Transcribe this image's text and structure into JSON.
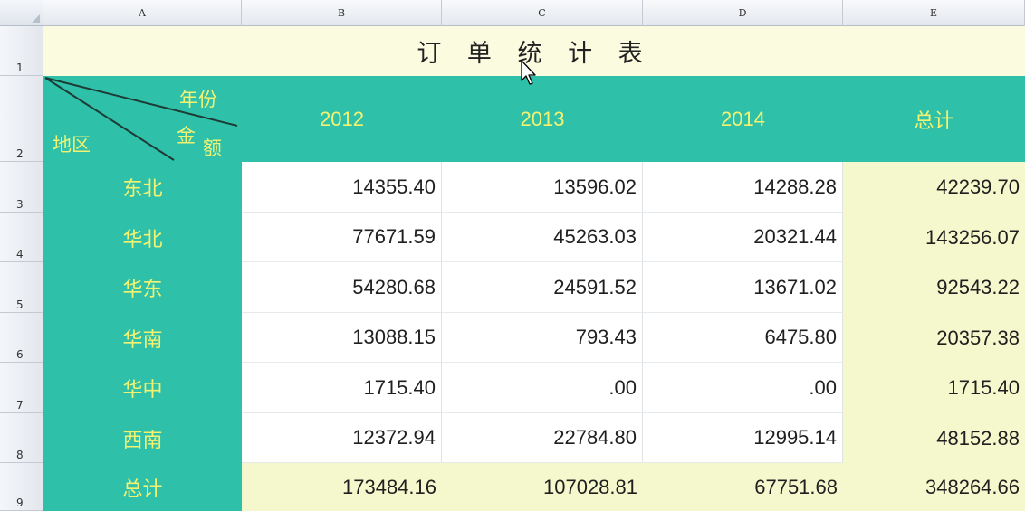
{
  "columns": [
    "A",
    "B",
    "C",
    "D",
    "E"
  ],
  "rows": [
    "1",
    "2",
    "3",
    "4",
    "5",
    "6",
    "7",
    "8",
    "9"
  ],
  "title": "订 单 统 计 表",
  "header": {
    "corner_top": "年份",
    "corner_middle_a": "金",
    "corner_middle_b": "额",
    "corner_bottom": "地区",
    "years": [
      "2012",
      "2013",
      "2014"
    ],
    "total": "总计"
  },
  "data_rows": [
    {
      "region": "东北",
      "v2012": "14355.40",
      "v2013": "13596.02",
      "v2014": "14288.28",
      "total": "42239.70"
    },
    {
      "region": "华北",
      "v2012": "77671.59",
      "v2013": "45263.03",
      "v2014": "20321.44",
      "total": "143256.07"
    },
    {
      "region": "华东",
      "v2012": "54280.68",
      "v2013": "24591.52",
      "v2014": "13671.02",
      "total": "92543.22"
    },
    {
      "region": "华南",
      "v2012": "13088.15",
      "v2013": "793.43",
      "v2014": "6475.80",
      "total": "20357.38"
    },
    {
      "region": "华中",
      "v2012": "1715.40",
      "v2013": ".00",
      "v2014": ".00",
      "total": "1715.40"
    },
    {
      "region": "西南",
      "v2012": "12372.94",
      "v2013": "22784.80",
      "v2014": "12995.14",
      "total": "48152.88"
    }
  ],
  "total_row": {
    "region": "总计",
    "v2012": "173484.16",
    "v2013": "107028.81",
    "v2014": "67751.68",
    "total": "348264.66"
  },
  "colors": {
    "teal": "#2fc0a9",
    "yellow_text": "#f3f371",
    "light_yellow": "#f5f8cc",
    "title_bg": "#fbfbdf"
  }
}
